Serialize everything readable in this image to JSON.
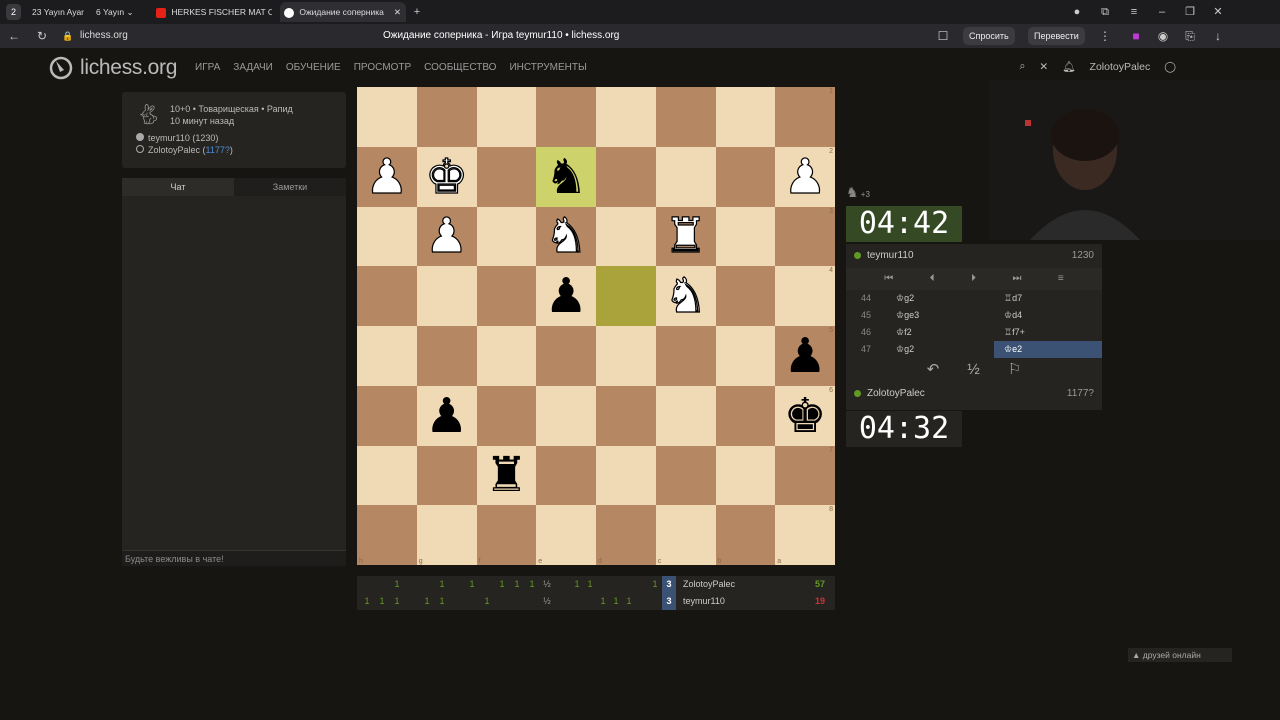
{
  "tabbar": {
    "workspace_badge": "2",
    "tabs": [
      {
        "count": "23",
        "label": "Yayın Ayar"
      },
      {
        "count": "6",
        "label": "Yayın"
      },
      {
        "label": "HERKES FISCHER MAT O..."
      },
      {
        "label": "Ожидание соперника"
      }
    ]
  },
  "addressbar": {
    "url": "lichess.org",
    "page_title": "Ожидание соперника - Игра teymur110 • lichess.org",
    "ask_label": "Спросить",
    "translate_label": "Перевести"
  },
  "header": {
    "logo_text": "lichess.org",
    "nav": [
      "ИГРА",
      "ЗАДАЧИ",
      "ОБУЧЕНИЕ",
      "ПРОСМОТР",
      "СООБЩЕСТВО",
      "ИНСТРУМЕНТЫ"
    ],
    "username": "ZolotoyPalec"
  },
  "game_meta": {
    "line1": "10+0 • Товарищеская • Рапид",
    "line2": "10 минут назад",
    "white_player": "teymur110 (1230)",
    "black_player_name": "ZolotoyPalec (",
    "black_player_rating": "1177?",
    "black_player_close": ")"
  },
  "chat": {
    "tab_chat": "Чат",
    "tab_notes": "Заметки",
    "placeholder": "Будьте вежливы в чате!"
  },
  "board": {
    "ranks_left_to_right_top_to_bottom": [
      [
        "",
        "",
        "",
        "",
        "",
        "",
        "",
        ""
      ],
      [
        "P",
        "K",
        "",
        "n",
        "",
        "",
        "",
        "P"
      ],
      [
        "",
        "P",
        "",
        "N",
        "",
        "R",
        "",
        ""
      ],
      [
        "",
        "",
        "",
        "p",
        "",
        "N",
        "",
        ""
      ],
      [
        "",
        "",
        "",
        "",
        "",
        "",
        "",
        "p"
      ],
      [
        "",
        "p",
        "",
        "",
        "",
        "",
        "",
        "k"
      ],
      [
        "",
        "",
        "r",
        "",
        "",
        "",
        "",
        ""
      ],
      [
        "",
        "",
        "",
        "",
        "",
        "",
        "",
        ""
      ]
    ],
    "last_move_squares": [
      "1-3",
      "3-4"
    ],
    "rank_labels": [
      "1",
      "2",
      "3",
      "4",
      "5",
      "6",
      "7",
      "8"
    ],
    "file_labels": [
      "h",
      "g",
      "f",
      "e",
      "d",
      "c",
      "b",
      "a"
    ]
  },
  "clocks": {
    "top_min": "04",
    "top_sec": "42",
    "bottom_min": "04",
    "bottom_sec": "32",
    "material_diff": "+3"
  },
  "panel": {
    "top_player": "teymur110",
    "top_rating": "1230",
    "bottom_player": "ZolotoyPalec",
    "bottom_rating": "1177?",
    "moves": [
      {
        "no": "44",
        "white": "♔g2",
        "black": "♖d7"
      },
      {
        "no": "45",
        "white": "♔ge3",
        "black": "♔d4"
      },
      {
        "no": "46",
        "white": "♔f2",
        "black": "♖f7+"
      },
      {
        "no": "47",
        "white": "♔g2",
        "black": "♔e2"
      }
    ],
    "takeback": "↶",
    "draw": "½",
    "resign": "⚐"
  },
  "crosstable": {
    "row1_name": "ZolotoyPalec",
    "row1_score": "57",
    "row2_name": "teymur110",
    "row2_score": "19",
    "current": "3",
    "row1_cells": [
      "",
      "",
      "1",
      "",
      "",
      "1",
      "",
      "1",
      "",
      "1",
      "1",
      "1",
      "½",
      "1",
      "1",
      "",
      "",
      "",
      "",
      "1"
    ],
    "row2_cells": [
      "1",
      "1",
      "1",
      "",
      "1",
      "1",
      "",
      "",
      "1",
      "",
      "",
      "",
      "½",
      "",
      "",
      "1",
      "1",
      "1",
      "",
      " "
    ]
  },
  "friends": "▲ друзей онлайн",
  "colors": {
    "accent_green": "#629924",
    "clock_active": "#354a24"
  }
}
